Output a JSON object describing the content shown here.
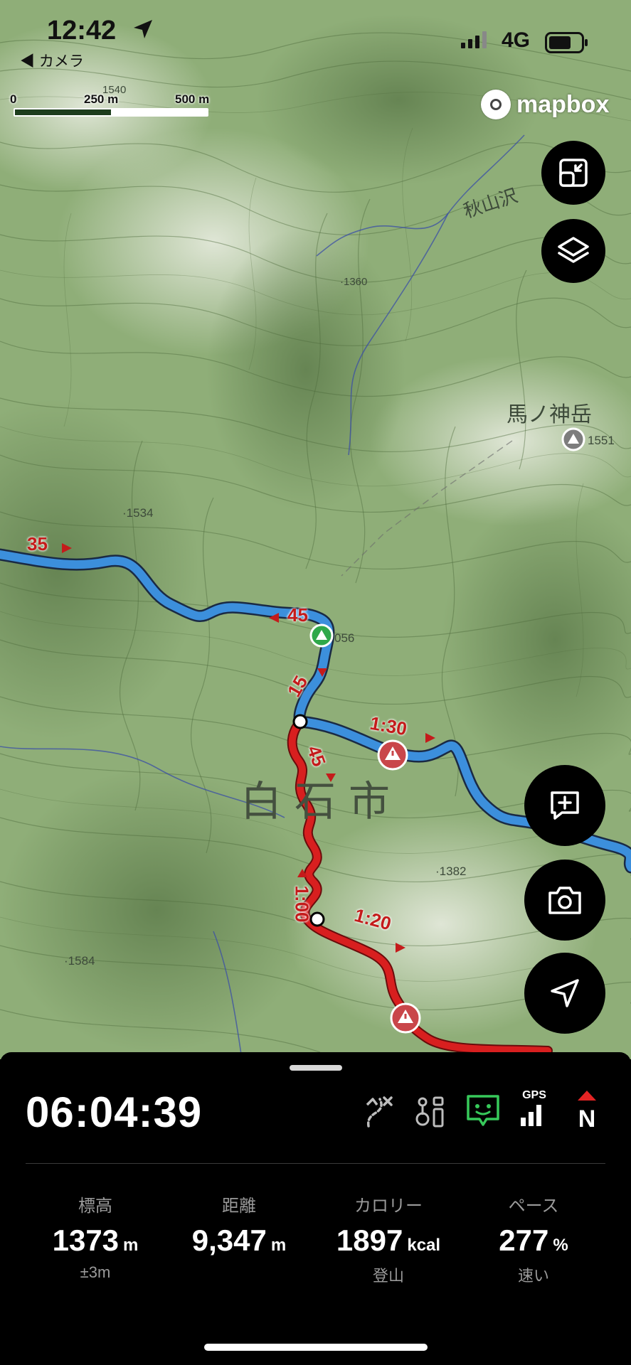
{
  "status_bar": {
    "time": "12:42",
    "back_label": "◀ カメラ",
    "network": "4G"
  },
  "map": {
    "scale": {
      "tick_0": "0",
      "tick_1": "250 m",
      "tick_2": "500 m"
    },
    "attribution": "mapbox",
    "places": {
      "akiyamasawa": "秋山沢",
      "umanokamidake": "馬ノ神岳",
      "shiroishi": "白石市"
    },
    "elevations": {
      "e1540": "1540",
      "e1360": "·1360",
      "e1551": "1551",
      "e1534": "·1534",
      "e1056": "056",
      "e1382": "·1382",
      "e1584": "·1584"
    },
    "route_labels": {
      "l35": "35",
      "l45a": "45",
      "l15": "15",
      "l130": "1:30",
      "l45b": "45",
      "l100": "1:00",
      "l120": "1:20"
    }
  },
  "panel": {
    "elapsed_time": "06:04:39",
    "gps_label": "GPS",
    "compass_label": "N",
    "stats": [
      {
        "label": "標高",
        "value": "1373",
        "unit": "m",
        "sub": "±3m"
      },
      {
        "label": "距離",
        "value": "9,347",
        "unit": "m",
        "sub": ""
      },
      {
        "label": "カロリー",
        "value": "1897",
        "unit": "kcal",
        "sub": "登山"
      },
      {
        "label": "ペース",
        "value": "277",
        "unit": "%",
        "sub": "速い"
      }
    ]
  },
  "colors": {
    "route_blue": "#3c8fdc",
    "route_red": "#d81f1f",
    "map_green": "#8fae78",
    "gps_green": "#37c95a"
  },
  "icons": [
    "location-arrow-icon",
    "signal-bars-icon",
    "battery-icon",
    "minimize-icon",
    "layers-icon",
    "add-comment-icon",
    "camera-icon",
    "navigation-icon",
    "off-route-icon",
    "waypoints-icon",
    "speech-bubble-icon",
    "gps-signal-icon",
    "compass-north-icon"
  ]
}
